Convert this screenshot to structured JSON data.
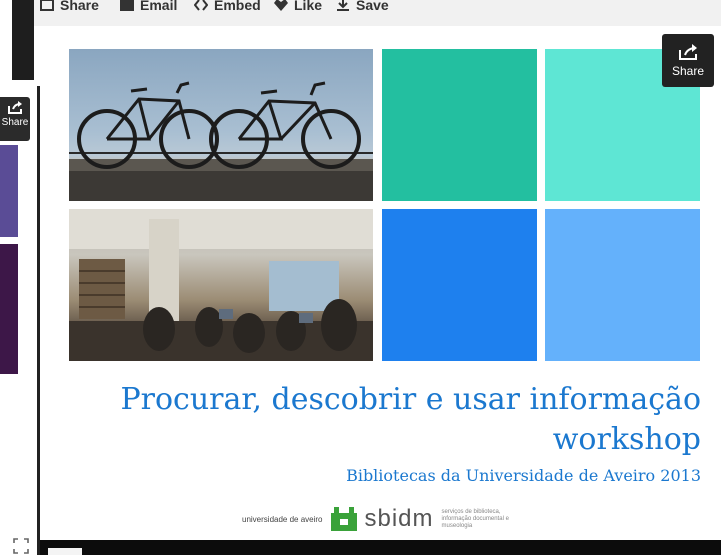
{
  "toolbar": {
    "items": [
      {
        "label": "Share",
        "icon": "share-icon"
      },
      {
        "label": "Email",
        "icon": "email-icon"
      },
      {
        "label": "Embed",
        "icon": "embed-icon"
      },
      {
        "label": "Like",
        "icon": "heart-icon"
      },
      {
        "label": "Save",
        "icon": "save-icon"
      }
    ]
  },
  "share_button": {
    "label": "Share",
    "icon": "share-icon"
  },
  "left_share_button": {
    "label": "Share"
  },
  "slide": {
    "title_line1": "Procurar, descobrir e usar informação",
    "title_line2": "workshop",
    "subtitle": "Bibliotecas da Universidade de Aveiro 2013",
    "logo_university": "universidade de aveiro",
    "logo_sbidm": "sbidm",
    "logo_sbidm_caption": "serviços de biblioteca, informação documental e museologia",
    "photos": [
      "bicycles-photo",
      "library-study-room-photo"
    ]
  },
  "colors": {
    "title": "#1b78cf",
    "tile_teal": "#23bfa0",
    "tile_aqua": "#5ee6d4",
    "tile_blue": "#1e80ee",
    "tile_light_blue": "#64b1fb",
    "logo_green": "#3aa23a"
  }
}
